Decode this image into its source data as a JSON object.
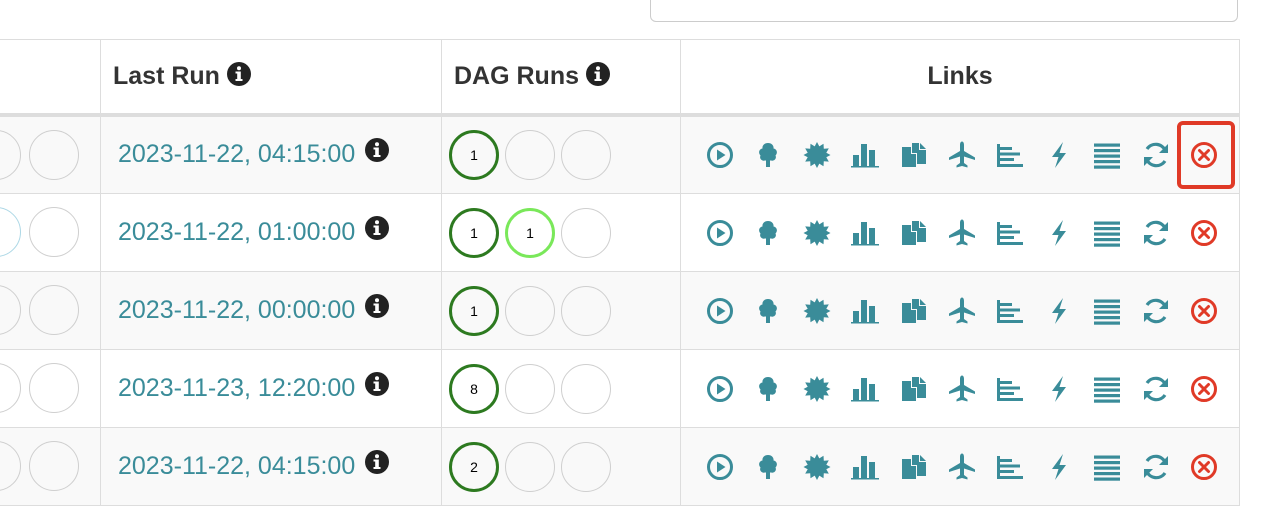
{
  "columns": {
    "last_run": "Last Run",
    "dag_runs": "DAG Runs",
    "links": "Links"
  },
  "colors": {
    "link": "#3a8c99",
    "icon": "#3a8c99",
    "delete": "#e03a27",
    "success": "#2d7a20",
    "running": "#7ae85a",
    "highlight": "#e03a27"
  },
  "rows": [
    {
      "last_run": "2023-11-22, 04:15:00",
      "dag_runs": [
        {
          "state": "success",
          "count": "1"
        },
        {
          "state": "none",
          "count": ""
        },
        {
          "state": "none",
          "count": ""
        }
      ]
    },
    {
      "last_run": "2023-11-22, 01:00:00",
      "dag_runs": [
        {
          "state": "success",
          "count": "1"
        },
        {
          "state": "running",
          "count": "1"
        },
        {
          "state": "none",
          "count": ""
        }
      ]
    },
    {
      "last_run": "2023-11-22, 00:00:00",
      "dag_runs": [
        {
          "state": "success",
          "count": "1"
        },
        {
          "state": "none",
          "count": ""
        },
        {
          "state": "none",
          "count": ""
        }
      ]
    },
    {
      "last_run": "2023-11-23, 12:20:00",
      "dag_runs": [
        {
          "state": "success",
          "count": "8"
        },
        {
          "state": "none",
          "count": ""
        },
        {
          "state": "none",
          "count": ""
        }
      ]
    },
    {
      "last_run": "2023-11-22, 04:15:00",
      "dag_runs": [
        {
          "state": "success",
          "count": "2"
        },
        {
          "state": "none",
          "count": ""
        },
        {
          "state": "none",
          "count": ""
        }
      ]
    }
  ],
  "link_icons": [
    "trigger-dag-icon",
    "tree-view-icon",
    "graph-view-icon",
    "duration-chart-icon",
    "task-tries-icon",
    "landing-times-icon",
    "gantt-icon",
    "code-icon",
    "logs-icon",
    "refresh-icon",
    "delete-icon"
  ],
  "highlighted": {
    "row": 0,
    "icon": "delete-icon"
  }
}
